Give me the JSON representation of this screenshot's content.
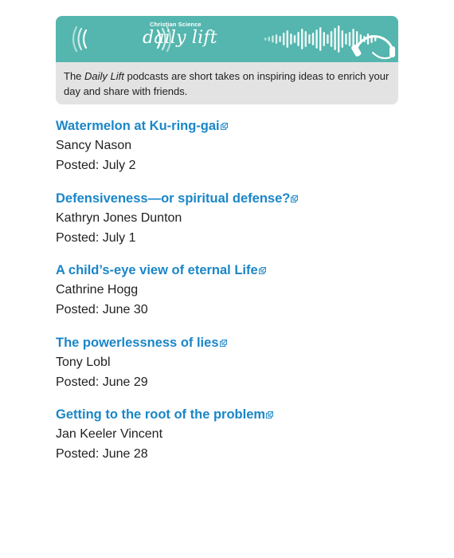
{
  "banner": {
    "brand_small": "Christian Science",
    "brand_name": "daily lift",
    "description_prefix": "The ",
    "description_em": "Daily Lift",
    "description_suffix": " podcasts are short takes on inspiring ideas to enrich your day and share with friends.",
    "colors": {
      "teal": "#54b6ae",
      "card_bg": "#e3e3e3",
      "link": "#1a86c8"
    }
  },
  "articles": [
    {
      "title": "Watermelon at Ku-ring-gai",
      "author": "Sancy Nason",
      "date": "Posted: July 2",
      "icon": "external-link-icon"
    },
    {
      "title": "Defensiveness—or spiritual defense?",
      "author": "Kathryn Jones Dunton",
      "date": "Posted: July 1",
      "icon": "external-link-icon"
    },
    {
      "title": "A child’s-eye view of eternal Life",
      "author": "Cathrine Hogg",
      "date": "Posted: June 30",
      "icon": "external-link-icon"
    },
    {
      "title": "The powerlessness of lies",
      "author": "Tony Lobl",
      "date": "Posted: June 29",
      "icon": "external-link-icon"
    },
    {
      "title": "Getting to the root of the problem",
      "author": "Jan Keeler Vincent",
      "date": "Posted: June 28",
      "icon": "external-link-icon"
    }
  ]
}
